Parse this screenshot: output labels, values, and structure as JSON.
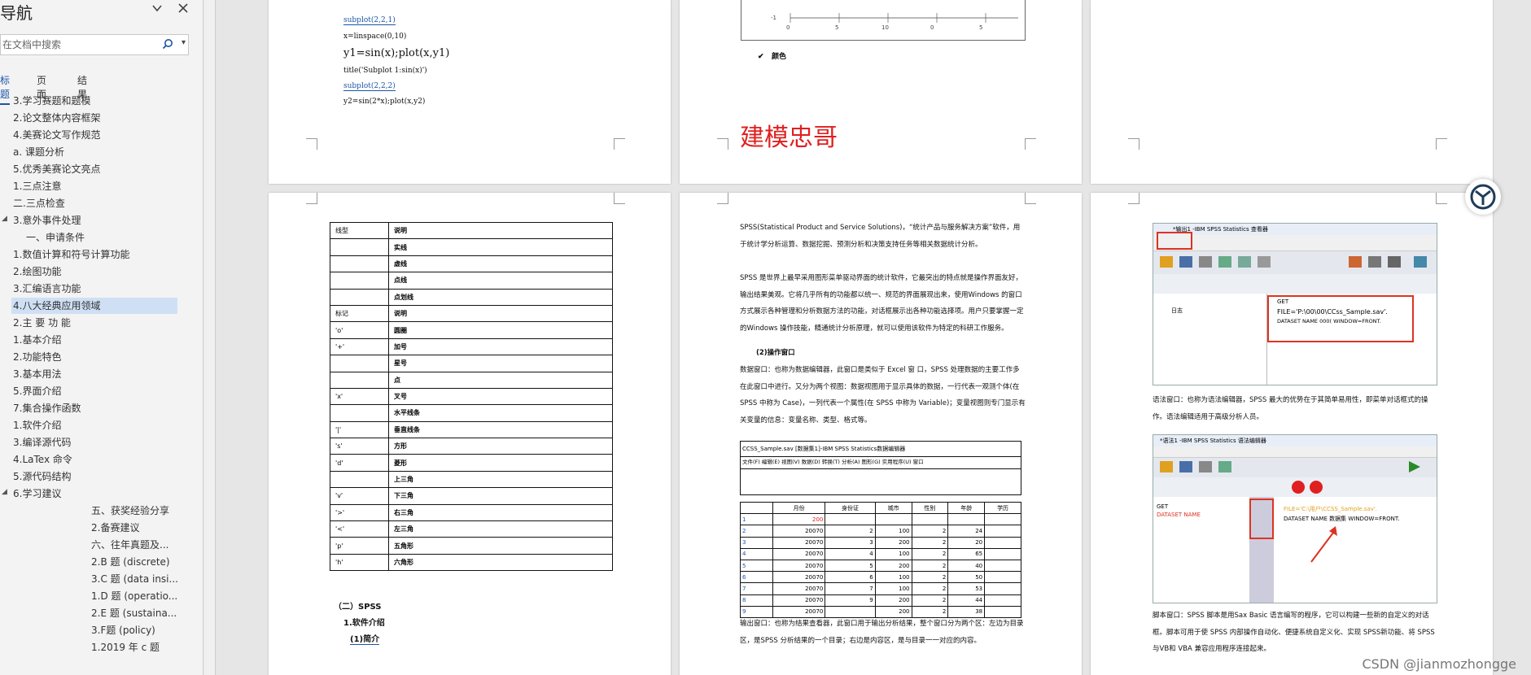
{
  "nav": {
    "title": "导航",
    "search_placeholder": "在文档中搜索",
    "tabs": [
      "标题",
      "页面",
      "结果"
    ],
    "items": [
      {
        "label": "3.学习赛题和题模"
      },
      {
        "label": "2.论文整体内容框架"
      },
      {
        "label": "4.美赛论文写作规范"
      },
      {
        "label": "a. 课题分析"
      },
      {
        "label": "5.优秀美赛论文亮点"
      },
      {
        "label": "1.三点注意"
      },
      {
        "label": "二.三点检查"
      },
      {
        "label": "3.意外事件处理"
      },
      {
        "label": "一、申请条件"
      },
      {
        "label": "1.数值计算和符号计算功能"
      },
      {
        "label": "2.绘图功能"
      },
      {
        "label": "3.汇编语言功能"
      },
      {
        "label": "4.八大经典应用领域"
      },
      {
        "label": "2.主 要 功 能"
      },
      {
        "label": "1.基本介绍"
      },
      {
        "label": "2.功能特色"
      },
      {
        "label": "3.基本用法"
      },
      {
        "label": "5.界面介绍"
      },
      {
        "label": "7.集合操作函数"
      },
      {
        "label": "1.软件介绍"
      },
      {
        "label": "3.编译源代码"
      },
      {
        "label": "4.LaTex  命令"
      },
      {
        "label": "5.源代码结构"
      },
      {
        "label": "6.学习建议"
      },
      {
        "label": "五、获奖经验分享"
      },
      {
        "label": "2.备赛建议"
      },
      {
        "label": "六、往年真题及..."
      },
      {
        "label": "2.B 题 (discrete)"
      },
      {
        "label": "3.C 题 (data  insi..."
      },
      {
        "label": "1.D 题 (operatio..."
      },
      {
        "label": "2.E 题 (sustaina..."
      },
      {
        "label": "3.F题 (policy)"
      },
      {
        "label": "1.2019 年 c 题"
      }
    ]
  },
  "page1": {
    "lines": [
      "subplot(2,2,1)",
      "x=linspace(0,10)",
      "y1=sin(x);plot(x,y1)",
      "title('Subplot           1:sin(x)')",
      "subplot(2,2,2)",
      "y2=sin(2*x);plot(x,y2)"
    ]
  },
  "page2": {
    "bullet": "颜色",
    "watermark_text": "建模忠哥"
  },
  "page4": {
    "table_rows": [
      [
        "线型",
        "说明"
      ],
      [
        "",
        "实线"
      ],
      [
        "",
        "虚线"
      ],
      [
        "",
        "点线"
      ],
      [
        "",
        "点划线"
      ],
      [
        "标记",
        "说明"
      ],
      [
        "'o'",
        "圆圈"
      ],
      [
        "'+'",
        "加号"
      ],
      [
        "",
        "星号"
      ],
      [
        "",
        "点"
      ],
      [
        "'x'",
        "叉号"
      ],
      [
        "",
        "水平线条"
      ],
      [
        "'|'",
        "垂直线条"
      ],
      [
        "'s'",
        "方形"
      ],
      [
        "'d'",
        "菱形"
      ],
      [
        "",
        "上三角"
      ],
      [
        "'v'",
        "下三角"
      ],
      [
        "'>'",
        "右三角"
      ],
      [
        "'<'",
        "左三角"
      ],
      [
        "'p'",
        "五角形"
      ],
      [
        "'h'",
        "六角形"
      ]
    ],
    "heading": "（二）SPSS",
    "sub1": "1.软件介绍",
    "sub2": "(1)简介"
  },
  "page5": {
    "p1": "SPSS(Statistical    Product    and    Service    Solutions)，“统计产品与服务解决方案”软件，用于统计学分析运算、数据挖掘、预测分析和决策支持任务等相关数据统计分析。",
    "p2": "SPSS 是世界上最早采用图形菜单驱动界面的统计软件，它最突出的特点就是操作界面友好，输出结果美观。它将几乎所有的功能都以统一、规范的界面展现出来，使用Windows 的窗口方式展示各种管理和分析数据方法的功能，对话框展示出各种功能选择项。用户只要掌握一定的Windows 操作技能，精通统计分析原理，就可以使用该软件为特定的科研工作服务。",
    "sub": "(2)操作窗口",
    "p3": "数据窗口：也称为数据编辑器，此窗口是类似于 Excel  窗  口，SPSS 处理数据的主要工作多在此窗口中进行。又分为两个视图：数据视图用于显示具体的数据，一行代表一观测个体(在 SPSS 中称为 Case)，一列代表一个属性(在 SPSS 中称为 Variable)；变量视图则专门显示有关变量的信息：变量名称、类型、格式等。",
    "shot_title": "CCSS_Sample.sav  [数据集1]-IBM SPSS Statistics数据编辑器",
    "shot_menu": "文件(F) 编辑(E) 视图(V) 数据(D) 转换(T) 分析(A) 图形(G) 实用程序(U) 窗口",
    "table_head": [
      "",
      "月份",
      "身份证",
      "城市",
      "性别",
      "年龄",
      "学历"
    ],
    "table_rows": [
      [
        "1",
        "200",
        "",
        "",
        "",
        "",
        ""
      ],
      [
        "2",
        "20070",
        "2",
        "100",
        "2",
        "24",
        ""
      ],
      [
        "3",
        "20070",
        "3",
        "200",
        "2",
        "20",
        ""
      ],
      [
        "4",
        "20070",
        "4",
        "100",
        "2",
        "65",
        ""
      ],
      [
        "5",
        "20070",
        "5",
        "200",
        "2",
        "40",
        ""
      ],
      [
        "6",
        "20070",
        "6",
        "100",
        "2",
        "50",
        ""
      ],
      [
        "7",
        "20070",
        "7",
        "100",
        "2",
        "53",
        ""
      ],
      [
        "8",
        "20070",
        "9",
        "200",
        "2",
        "44",
        ""
      ],
      [
        "9",
        "20070",
        "",
        "200",
        "2",
        "38",
        ""
      ]
    ],
    "p4": "输出窗口：也称为结果查看器，此窗口用于输出分析结果，整个窗口分为两个区：左边为目录区，是SPSS 分析结果的一个目录；右边是内容区，是与目录一一对应的内容。"
  },
  "page6": {
    "shot1_title": "*输出1 -IBM SPSS Statistics 查看器",
    "shot1_get": "GET",
    "shot1_file": "FILE='P:\\00\\00\\CCss_Sample.sav'.",
    "shot1_ds": "DATASET NAME 000( WINDOW=FRONT.",
    "shot1_tree": "日志",
    "p1": "语法窗口：也称为语法编辑器，SPSS 最大的优势在于其简单易用性，即菜单对话框式的操作。语法编辑适用于高级分析人员。",
    "shot2_title": "*语法1 -IBM SPSS Statistics 语法编辑器",
    "shot2_get": "GET",
    "shot2_ds": "DATASET NAME",
    "shot2_file": "FILE='C:\\用户\\CCSS_Sample.sav'.",
    "shot2_ds2": "DATASET NAME 数据集  WINDOW=FRONT.",
    "p2": "脚本窗口：SPSS 脚本是用Sax Basic 语言编写的程序，它可以构建一些新的自定义的对话框。脚本可用于使 SPSS 内部操作自动化、便捷系统自定义化、实现 SPSS新功能、将 SPSS与VB和 VBA 兼容应用程序连接起来。"
  },
  "watermark": "CSDN @jianmozhongge",
  "colors": {
    "accent": "#1a55a8",
    "selected": "#cfe0f5",
    "red": "#e02020"
  }
}
